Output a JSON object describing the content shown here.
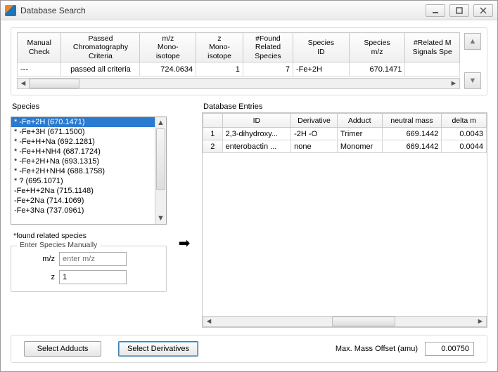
{
  "window": {
    "title": "Database Search"
  },
  "results": {
    "headers": {
      "manual_check": "Manual\nCheck",
      "passed_crit": "Passed\nChromatography\nCriteria",
      "mz_mono": "m/z\nMono-\nisotope",
      "z_mono": "z\nMono-\nisotope",
      "found_related": "#Found\nRelated\nSpecies",
      "species_id": "Species\nID",
      "species_mz": "Species\nm/z",
      "related_sig": "#Related M\nSignals Spe"
    },
    "row": {
      "manual_check": "---",
      "passed_crit": "passed all criteria",
      "mz_mono": "724.0634",
      "z_mono": "1",
      "found_related": "7",
      "species_id": "-Fe+2H",
      "species_mz": "670.1471",
      "related_sig": ""
    }
  },
  "species": {
    "label": "Species",
    "footnote": "*found related species",
    "items": [
      "* -Fe+2H (670.1471)",
      "* -Fe+3H (671.1500)",
      "* -Fe+H+Na (692.1281)",
      "* -Fe+H+NH4 (687.1724)",
      "* -Fe+2H+Na (693.1315)",
      "* -Fe+2H+NH4 (688.1758)",
      "* ? (695.1071)",
      "-Fe+H+2Na (715.1148)",
      "-Fe+2Na (714.1069)",
      "-Fe+3Na (737.0961)"
    ],
    "selected_index": 0
  },
  "manual_entry": {
    "legend": "Enter Species Manually",
    "mz_label": "m/z",
    "mz_placeholder": "enter m/z",
    "z_label": "z",
    "z_value": "1"
  },
  "db": {
    "label": "Database Entries",
    "headers": {
      "row": "",
      "id": "ID",
      "derivative": "Derivative",
      "adduct": "Adduct",
      "neutral_mass": "neutral mass",
      "delta_m": "delta m"
    },
    "rows": [
      {
        "n": "1",
        "id": "2,3-dihydroxy...",
        "derivative": "-2H -O",
        "adduct": "Trimer",
        "neutral_mass": "669.1442",
        "delta_m": "0.0043"
      },
      {
        "n": "2",
        "id": "enterobactin ...",
        "derivative": "none",
        "adduct": "Monomer",
        "neutral_mass": "669.1442",
        "delta_m": "0.0044"
      }
    ]
  },
  "bottom": {
    "adducts_btn": "Select Adducts",
    "derivatives_btn": "Select Derivatives",
    "offset_label": "Max. Mass Offset (amu)",
    "offset_value": "0.00750"
  }
}
